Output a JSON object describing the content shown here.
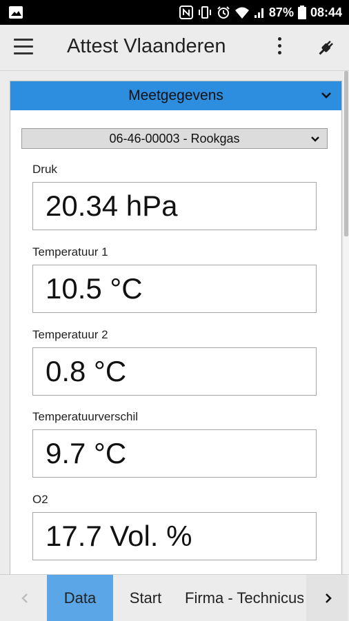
{
  "status_bar": {
    "battery": "87%",
    "time": "08:44",
    "icons": [
      "image-icon",
      "nfc-icon",
      "vibrate-icon",
      "alarm-icon",
      "wifi-icon",
      "signal-icon",
      "battery-icon"
    ]
  },
  "app_bar": {
    "title": "Attest Vlaanderen",
    "icons": [
      "menu-icon",
      "more-vert-icon",
      "plug-icon"
    ]
  },
  "panel": {
    "header": "Meetgegevens",
    "device": "06-46-00003 - Rookgas",
    "fields": [
      {
        "label": "Druk",
        "value": "20.34 hPa"
      },
      {
        "label": "Temperatuur 1",
        "value": "10.5 °C"
      },
      {
        "label": "Temperatuur 2",
        "value": "0.8 °C"
      },
      {
        "label": "Temperatuurverschil",
        "value": "9.7 °C"
      },
      {
        "label": "O2",
        "value": "17.7 Vol. %"
      }
    ]
  },
  "tabs": {
    "items": [
      "Data",
      "Start",
      "Firma - Technicus"
    ],
    "active": "Data"
  },
  "colors": {
    "header_blue": "#2d8ee0",
    "active_tab": "#5aa6e6"
  }
}
